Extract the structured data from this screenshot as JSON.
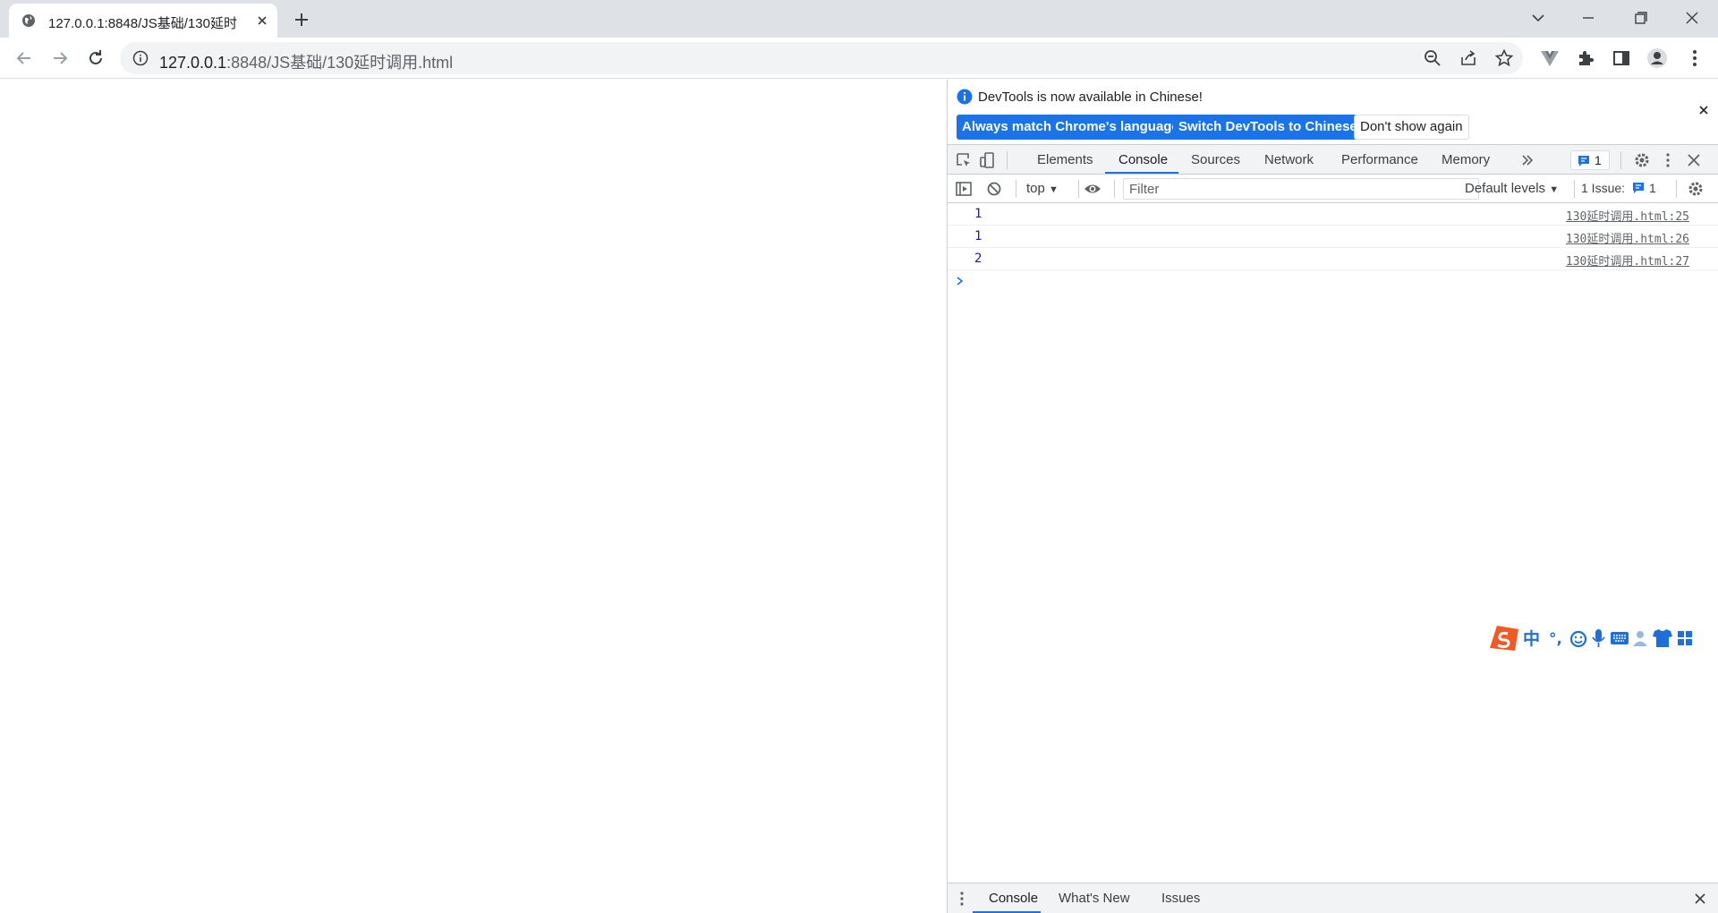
{
  "browser": {
    "tab_title": "127.0.0.1:8848/JS基础/130延时",
    "url_host": "127.0.0.1",
    "url_rest": ":8848/JS基础/130延时调用.html"
  },
  "devtools": {
    "infobar": {
      "message": "DevTools is now available in Chinese!",
      "btn_match": "Always match Chrome's language",
      "btn_switch": "Switch DevTools to Chinese",
      "btn_dont_show": "Don't show again"
    },
    "tabs": [
      "Elements",
      "Console",
      "Sources",
      "Network",
      "Performance",
      "Memory"
    ],
    "active_tab": "Console",
    "issues_badge_count": "1",
    "console_toolbar": {
      "context": "top",
      "filter_placeholder": "Filter",
      "levels": "Default levels",
      "issue_label": "1 Issue:",
      "issue_count": "1"
    },
    "messages": [
      {
        "value": "1",
        "source": "130延时调用.html:25"
      },
      {
        "value": "1",
        "source": "130延时调用.html:26"
      },
      {
        "value": "2",
        "source": "130延时调用.html:27"
      }
    ],
    "drawer_tabs": [
      "Console",
      "What's New",
      "Issues"
    ]
  },
  "ime": {
    "mode": "中",
    "punct": "°,"
  },
  "colors": {
    "accent": "#1a73e8",
    "tabstrip": "#dee1e6",
    "ime_logo": "#f25a24",
    "ime_icon": "#1e6fd9"
  }
}
